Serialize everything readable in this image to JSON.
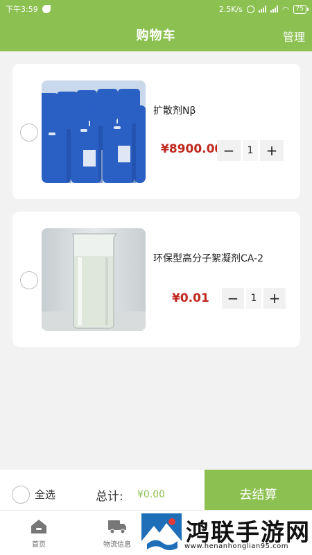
{
  "status_bar": {
    "time": "下午3:59",
    "speed": "2.5K/s",
    "battery": "75"
  },
  "header": {
    "title": "购物车",
    "manage_label": "管理"
  },
  "cart_items": [
    {
      "name": "扩散剂Nβ",
      "price": "¥8900.00",
      "quantity": "1",
      "image": "blue-chemical-drums-photo"
    },
    {
      "name": "环保型高分子絮凝剂CA-2",
      "price": "¥0.01",
      "quantity": "1",
      "image": "glass-beaker-liquid-photo"
    }
  ],
  "stepper": {
    "minus": "−",
    "plus": "+"
  },
  "checkout": {
    "select_all_label": "全选",
    "total_label": "总计:",
    "total_value": "¥0.00",
    "checkout_button": "去结算"
  },
  "tabs": [
    {
      "label": "首页",
      "icon": "home-icon"
    },
    {
      "label": "物流信息",
      "icon": "truck-icon"
    }
  ],
  "watermark": {
    "text": "鸿联手游网",
    "url": "www.henanhonglian95.com"
  },
  "colors": {
    "accent": "#8cc152",
    "price": "#c0281f",
    "background": "#f2f2f2"
  }
}
